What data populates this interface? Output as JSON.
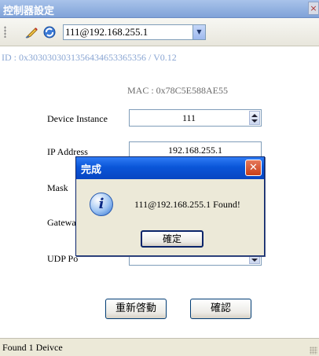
{
  "window": {
    "title": "控制器設定",
    "close_glyph": "×"
  },
  "toolbar": {
    "icons": [
      "edit-icon",
      "refresh-icon"
    ],
    "device_select": {
      "value": "111@192.168.255.1"
    }
  },
  "info": {
    "id_line": "ID : 0x3030303031356434653365356 / V0.12",
    "mac_line": "MAC : 0x78C5E588AE55"
  },
  "form": {
    "device_instance": {
      "label": "Device Instance",
      "value": "111"
    },
    "ip_address": {
      "label": "IP Address",
      "value": "192.168.255.1"
    },
    "mask": {
      "label": "Mask"
    },
    "gateway": {
      "label": "Gatewa"
    },
    "udp_port": {
      "label": "UDP Po"
    }
  },
  "buttons": {
    "restart": "重新啓動",
    "confirm": "確認"
  },
  "status": {
    "text": "Found 1 Deivce"
  },
  "dialog": {
    "title": "完成",
    "icon": "info-icon",
    "message": "111@192.168.255.1 Found!",
    "ok_label": "確定",
    "close_glyph": "✕"
  },
  "colors": {
    "titlebar": "#7fa2d8",
    "dialog_title": "#0a55d8",
    "id_text": "#8aa6d3"
  }
}
